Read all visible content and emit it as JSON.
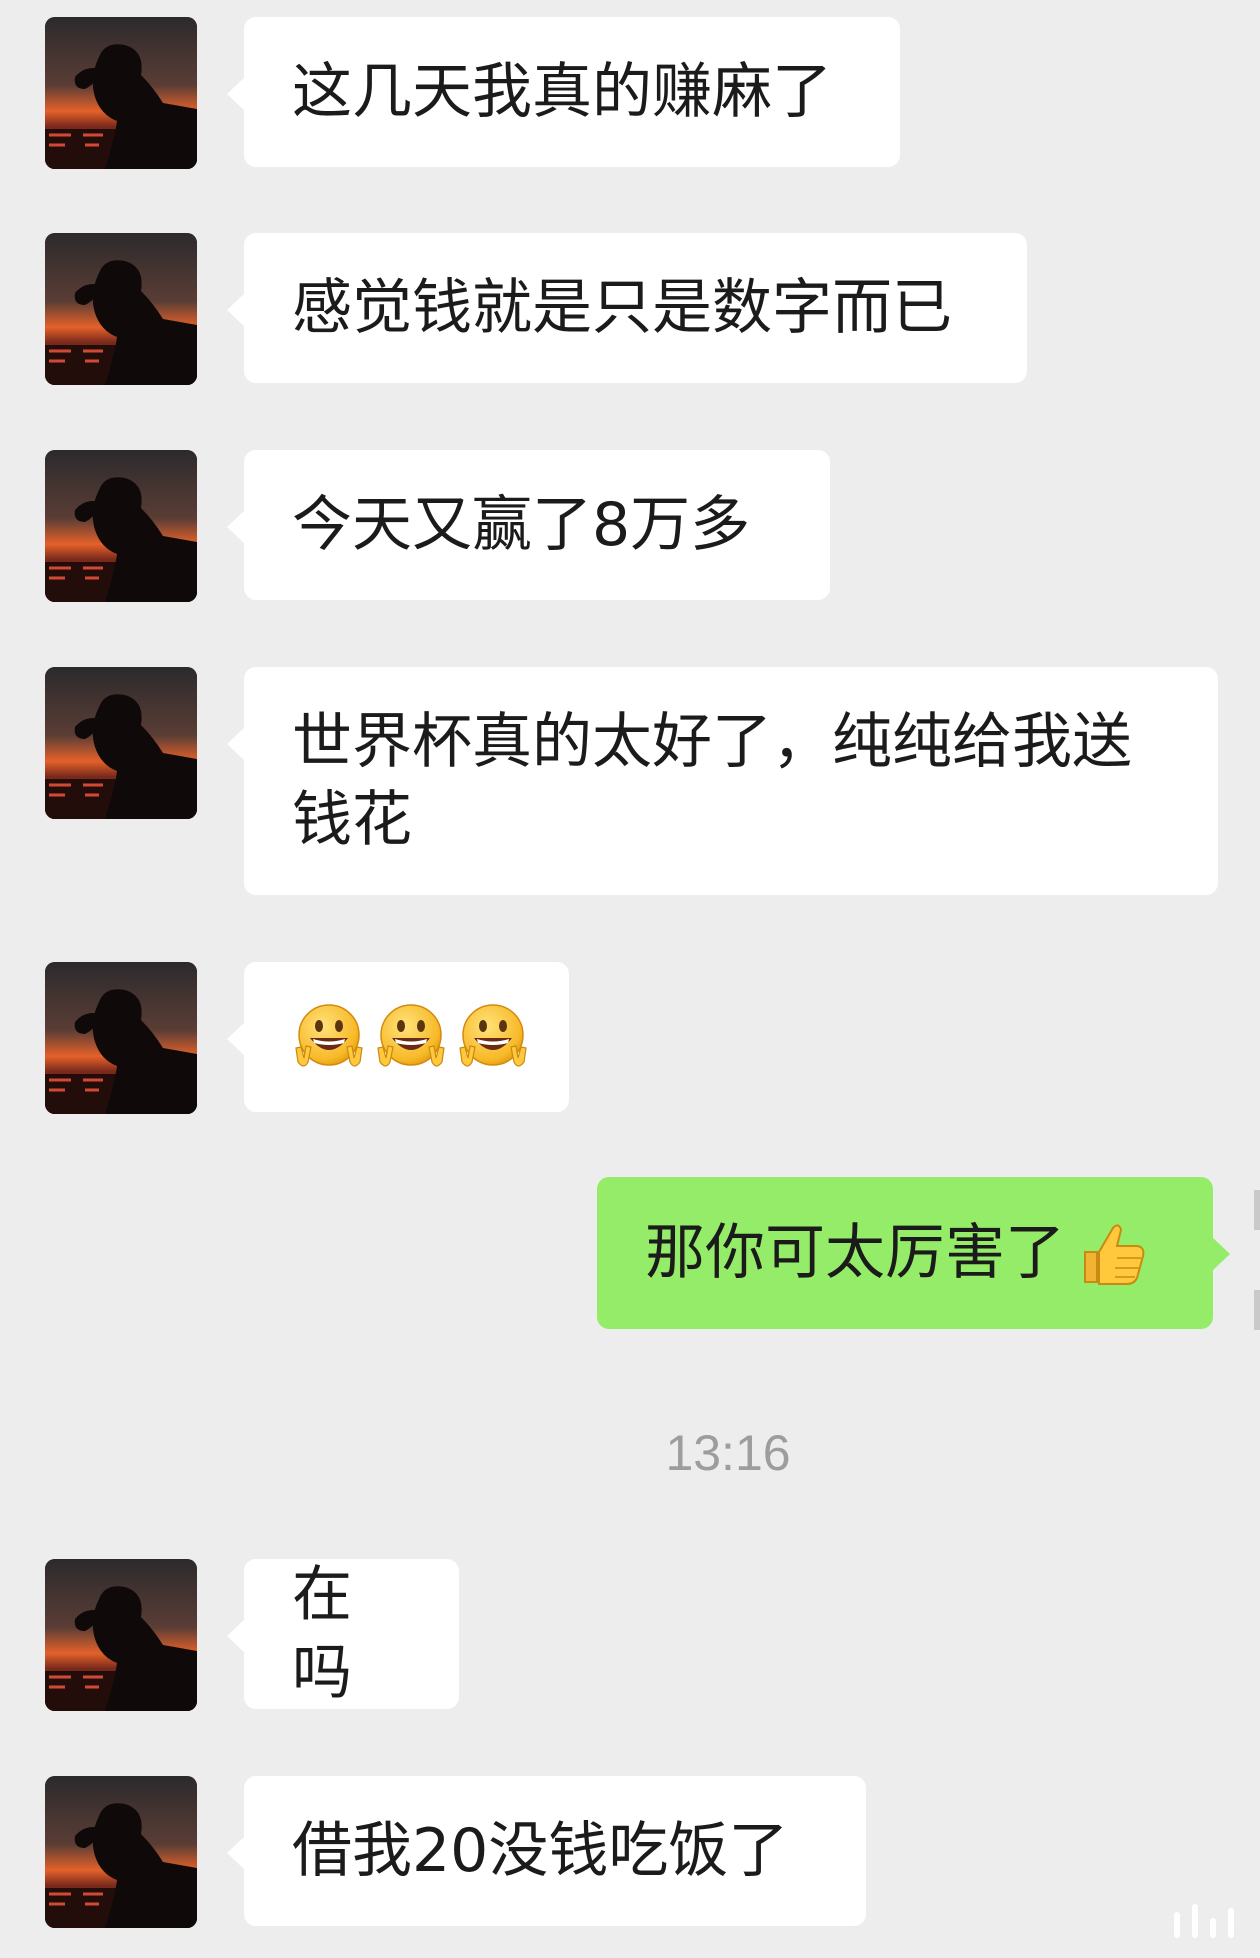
{
  "messages": [
    {
      "id": "m1",
      "side": "received",
      "text": "这几天我真的赚麻了"
    },
    {
      "id": "m2",
      "side": "received",
      "text": "感觉钱就是只是数字而已"
    },
    {
      "id": "m3",
      "side": "received",
      "text": "今天又赢了8万多"
    },
    {
      "id": "m4",
      "side": "received",
      "line1": "世界杯真的太好了，纯纯给我送",
      "line2": "钱花"
    },
    {
      "id": "m5",
      "side": "received",
      "emojis": [
        "grin-victory-emoji",
        "grin-victory-emoji",
        "grin-victory-emoji"
      ]
    },
    {
      "id": "m6",
      "side": "sent",
      "text": "那你可太厉害了",
      "emoji": "thumbs-up-emoji"
    },
    {
      "id": "m7",
      "side": "received",
      "text": "在吗"
    },
    {
      "id": "m8",
      "side": "received",
      "text": "借我20没钱吃饭了"
    }
  ],
  "timestamp": "13:16",
  "colors": {
    "background": "#ededed",
    "received_bubble": "#ffffff",
    "sent_bubble": "#95ec69",
    "timestamp": "#9d9d9d"
  }
}
